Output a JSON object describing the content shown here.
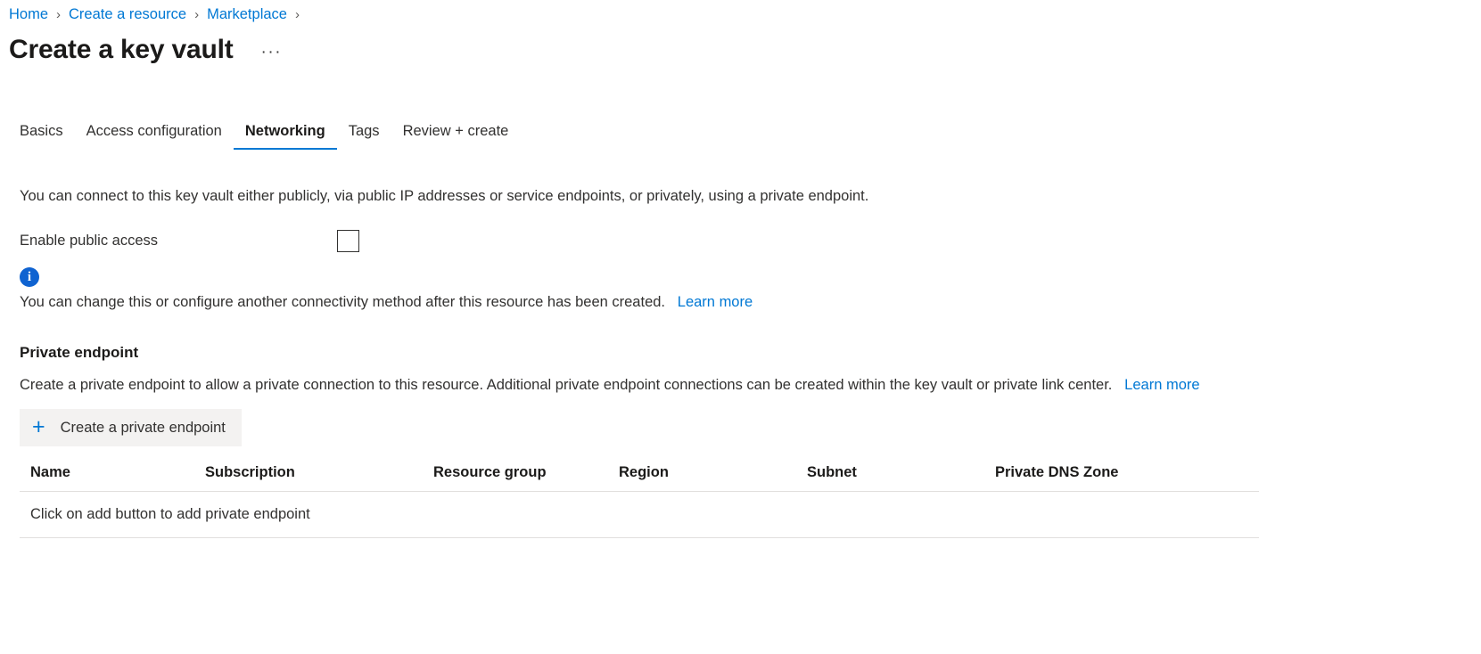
{
  "breadcrumb": {
    "items": [
      {
        "label": "Home"
      },
      {
        "label": "Create a resource"
      },
      {
        "label": "Marketplace"
      }
    ],
    "separator": "›"
  },
  "header": {
    "title": "Create a key vault",
    "more_label": "···"
  },
  "tabs": [
    {
      "label": "Basics",
      "active": false
    },
    {
      "label": "Access configuration",
      "active": false
    },
    {
      "label": "Networking",
      "active": true
    },
    {
      "label": "Tags",
      "active": false
    },
    {
      "label": "Review + create",
      "active": false
    }
  ],
  "networking": {
    "intro": "You can connect to this key vault either publicly, via public IP addresses or service endpoints, or privately, using a private endpoint.",
    "enable_public_access": {
      "label": "Enable public access",
      "checked": false
    },
    "info": {
      "icon": "info-icon",
      "glyph": "i",
      "text": "You can change this or configure another connectivity method after this resource has been created.",
      "learn_more": "Learn more"
    }
  },
  "private_endpoint": {
    "heading": "Private endpoint",
    "description": "Create a private endpoint to allow a private connection to this resource. Additional private endpoint connections can be created within the key vault or private link center.",
    "learn_more": "Learn more",
    "add_button": {
      "label": "Create a private endpoint",
      "icon": "plus-icon",
      "glyph": "+"
    },
    "table": {
      "columns": [
        "Name",
        "Subscription",
        "Resource group",
        "Region",
        "Subnet",
        "Private DNS Zone"
      ],
      "rows": [],
      "empty_message": "Click on add button to add private endpoint"
    }
  },
  "colors": {
    "accent": "#0078d4",
    "info": "#0f63d1",
    "text": "#323130",
    "heading": "#1b1a19",
    "button_bg": "#f3f2f1",
    "divider": "#e1dfdd"
  }
}
